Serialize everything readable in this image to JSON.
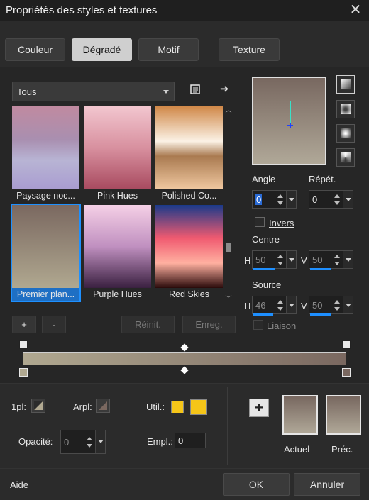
{
  "window": {
    "title": "Propriétés des styles et textures",
    "close_icon": "close-icon"
  },
  "tabs": [
    {
      "label": "Couleur",
      "active": false
    },
    {
      "label": "Dégradé",
      "active": true
    },
    {
      "label": "Motif",
      "active": false
    },
    {
      "label": "Texture",
      "active": false
    }
  ],
  "category": {
    "selected": "Tous"
  },
  "icons": {
    "library": "list-icon",
    "export": "arrow-right-icon"
  },
  "gradients": [
    {
      "name": "Paysage noc...",
      "colors": [
        "#c08aa0",
        "#a98fb0",
        "#b8b4d4",
        "#a99cd0"
      ]
    },
    {
      "name": "Pink Hues",
      "colors": [
        "#f2c6cf",
        "#d8909f",
        "#a84a5f"
      ]
    },
    {
      "name": "Polished Co...",
      "colors": [
        "#d08848",
        "#fbf2e6",
        "#a97a50",
        "#f0c8a0"
      ]
    },
    {
      "name": "Premier plan...",
      "colors": [
        "#7a6860",
        "#b0a890"
      ],
      "selected": true
    },
    {
      "name": "Purple Hues",
      "colors": [
        "#f5d0e6",
        "#c090c0",
        "#3a2040"
      ]
    },
    {
      "name": "Red Skies",
      "colors": [
        "#1a3a8a",
        "#f05a70",
        "#ffb0a0",
        "#2a0a0a"
      ]
    }
  ],
  "gallery_buttons": {
    "add": "+",
    "remove": "-",
    "reset": "Réinit.",
    "save": "Enreg."
  },
  "angle": {
    "label": "Angle",
    "value": "0"
  },
  "repeat": {
    "label": "Répét.",
    "value": "0"
  },
  "invert": {
    "label": "Invers",
    "checked": false
  },
  "centre": {
    "label": "Centre",
    "h_label": "H",
    "h_value": "50",
    "v_label": "V",
    "v_value": "50"
  },
  "source": {
    "label": "Source",
    "h_label": "H",
    "h_value": "46",
    "v_label": "V",
    "v_value": "50"
  },
  "link": {
    "label": "Liaison",
    "checked": false
  },
  "gradient_bar": {
    "start_color": "#b0a890",
    "end_color": "#7a6860"
  },
  "bottom": {
    "fg_label": "1pl:",
    "bg_label": "Arpl:",
    "use_label": "Util.:",
    "use_color": "#f5c518",
    "opacity_label": "Opacité:",
    "opacity_value": "0",
    "location_label": "Empl.:",
    "location_value": "0",
    "add_icon": "plus-icon",
    "current_label": "Actuel",
    "previous_label": "Préc."
  },
  "footer": {
    "help": "Aide",
    "ok": "OK",
    "cancel": "Annuler"
  }
}
